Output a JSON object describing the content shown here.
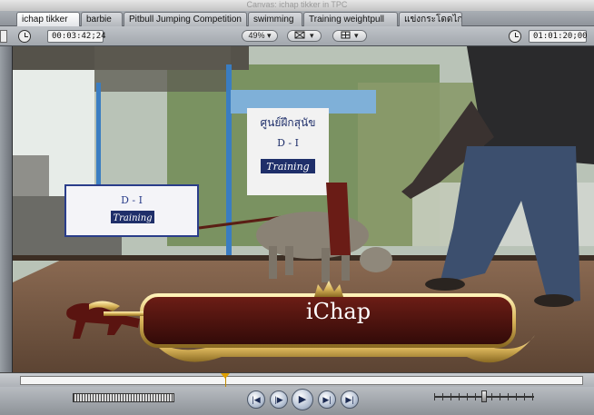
{
  "window": {
    "title": "Canvas: ichap tikker in TPC"
  },
  "tabs": [
    {
      "label": "ichap tikker",
      "active": true
    },
    {
      "label": "barbie",
      "active": false
    },
    {
      "label": "Pitbull Jumping Competition",
      "active": false
    },
    {
      "label": "swimming",
      "active": false
    },
    {
      "label": "Training weightpull",
      "active": false
    },
    {
      "label": "แข่งกระโดดไกล",
      "active": false
    }
  ],
  "toolbar": {
    "duration_timecode": "00:03:42;24",
    "zoom": "49%",
    "view_mode_icon": "view-mode-icon",
    "overlay_icon": "overlay-icon",
    "current_timecode": "01:01:20;00"
  },
  "video": {
    "banner_sign_line1": "ศูนย์ฝึกสุนัข",
    "banner_sign_line2": "D - I",
    "banner_sign_line3": "Training",
    "crate_sign_line1": "D - I",
    "crate_sign_line2": "Training",
    "lower_third_title": "iChap"
  },
  "transport": {
    "buttons": [
      "go-to-previous-edit-icon",
      "play-in-to-out-icon",
      "play-icon",
      "play-around-current-icon",
      "go-to-next-edit-icon"
    ]
  },
  "playhead_fraction": 0.364,
  "colors": {
    "lower_third_fill": "#4a1410",
    "lower_third_gold": "#d9b45a",
    "playhead": "#e0a000"
  }
}
